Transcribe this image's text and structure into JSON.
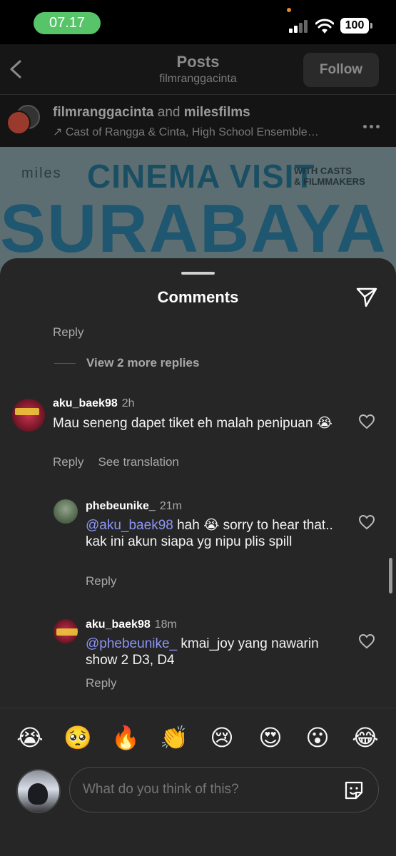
{
  "status": {
    "time": "07.17",
    "battery": "100"
  },
  "header": {
    "title": "Posts",
    "subtitle": "filmranggacinta",
    "follow_label": "Follow"
  },
  "post": {
    "author_a": "filmranggacinta",
    "conjunction": "and",
    "author_b": "milesfilms",
    "audio": "↗ Cast of Rangga & Cinta, High School Ensemble…",
    "image_brand": "miles",
    "image_title": "CINEMA VISIT",
    "image_with_line1": "WITH CASTS",
    "image_with_line2": "& FILMMAKERS",
    "image_city": "SURABAYA"
  },
  "sheet": {
    "title": "Comments",
    "top_reply": "Reply",
    "view_more": "View 2 more replies",
    "comments": [
      {
        "user": "aku_baek98",
        "time": "2h",
        "text": "Mau seneng dapet tiket eh malah penipuan 😭",
        "reply": "Reply",
        "translate": "See translation"
      },
      {
        "user": "phebeunike_",
        "time": "21m",
        "mention": "@aku_baek98",
        "text": " hah 😭 sorry to hear that.. kak ini akun siapa yg nipu plis spill",
        "reply": "Reply"
      },
      {
        "user": "aku_baek98",
        "time": "18m",
        "mention": "@phebeunike_",
        "text": " kmai_joy yang nawarin show 2 D3, D4",
        "reply": "Reply"
      }
    ],
    "emojis": [
      "😭",
      "🥺",
      "🔥",
      "👏",
      "😢",
      "😍",
      "😮",
      "😂"
    ],
    "composer_placeholder": "What do you think of this?"
  }
}
